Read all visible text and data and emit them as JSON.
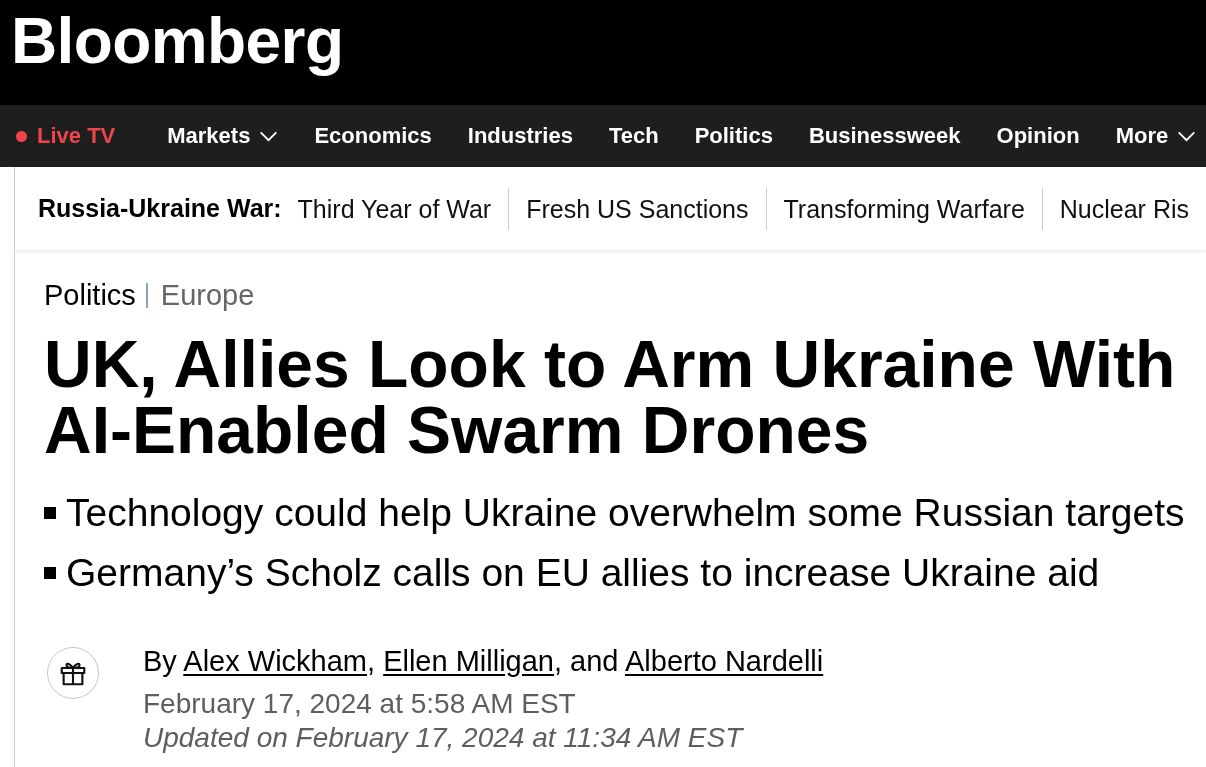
{
  "masthead": {
    "logo": "Bloomberg"
  },
  "nav": {
    "items": [
      {
        "label": "Live TV",
        "kind": "live"
      },
      {
        "label": "Markets",
        "kind": "dropdown"
      },
      {
        "label": "Economics",
        "kind": "link"
      },
      {
        "label": "Industries",
        "kind": "link"
      },
      {
        "label": "Tech",
        "kind": "link"
      },
      {
        "label": "Politics",
        "kind": "link"
      },
      {
        "label": "Businessweek",
        "kind": "link"
      },
      {
        "label": "Opinion",
        "kind": "link"
      },
      {
        "label": "More",
        "kind": "dropdown"
      }
    ]
  },
  "topic_bar": {
    "label": "Russia-Ukraine War:",
    "links": [
      "Third Year of War",
      "Fresh US Sanctions",
      "Transforming Warfare",
      "Nuclear Ris"
    ]
  },
  "article": {
    "section": "Politics",
    "subsection": "Europe",
    "headline": "UK, Allies Look to Arm Ukraine With AI-Enabled Swarm Drones",
    "bullets": [
      "Technology could help Ukraine overwhelm some Russian targets",
      "Germany’s Scholz calls on EU allies to increase Ukraine aid"
    ],
    "byline": [
      {
        "kind": "text",
        "text": "By "
      },
      {
        "kind": "link",
        "text": "Alex Wickham"
      },
      {
        "kind": "text",
        "text": ", "
      },
      {
        "kind": "link",
        "text": "Ellen Milligan"
      },
      {
        "kind": "text",
        "text": ", and "
      },
      {
        "kind": "link",
        "text": "Alberto Nardelli"
      }
    ],
    "published": "February 17, 2024 at 5:58 AM EST",
    "updated": "Updated on February 17, 2024 at 11:34 AM EST"
  }
}
